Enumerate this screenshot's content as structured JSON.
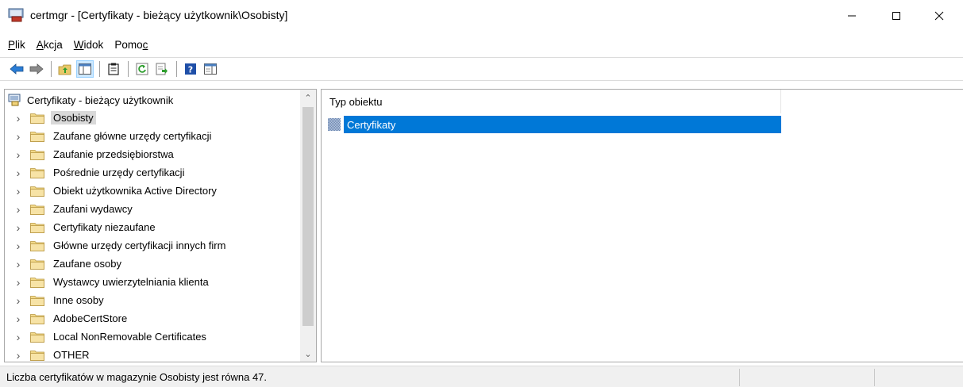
{
  "window": {
    "title": "certmgr - [Certyfikaty - bieżący użytkownik\\Osobisty]",
    "icon": "certmgr-app-icon"
  },
  "menu": [
    {
      "pre": "",
      "ul": "P",
      "post": "lik"
    },
    {
      "pre": "",
      "ul": "A",
      "post": "kcja"
    },
    {
      "pre": "",
      "ul": "W",
      "post": "idok"
    },
    {
      "pre": "Pomo",
      "ul": "c",
      "post": ""
    }
  ],
  "toolbar": {
    "icons": [
      "back-arrow-icon",
      "forward-arrow-icon",
      "up-folder-icon",
      "show-tree-icon",
      "clipboard-icon",
      "refresh-icon",
      "export-list-icon",
      "help-icon",
      "properties-pane-icon"
    ]
  },
  "tree": {
    "root_label": "Certyfikaty - bieżący użytkownik",
    "items": [
      "Osobisty",
      "Zaufane główne urzędy certyfikacji",
      "Zaufanie przedsiębiorstwa",
      "Pośrednie urzędy certyfikacji",
      "Obiekt użytkownika Active Directory",
      "Zaufani wydawcy",
      "Certyfikaty niezaufane",
      "Główne urzędy certyfikacji innych firm",
      "Zaufane osoby",
      "Wystawcy uwierzytelniania klienta",
      "Inne osoby",
      "AdobeCertStore",
      "Local NonRemovable Certificates",
      "OTHER"
    ],
    "selected_index": 0
  },
  "list": {
    "column_header": "Typ obiektu",
    "rows": [
      "Certyfikaty"
    ]
  },
  "status": {
    "text": "Liczba certyfikatów w magazynie Osobisty jest równa 47."
  },
  "colors": {
    "selection": "#0078d7",
    "tree_selection": "#d9d9d9",
    "folder": "#e8c86a"
  }
}
